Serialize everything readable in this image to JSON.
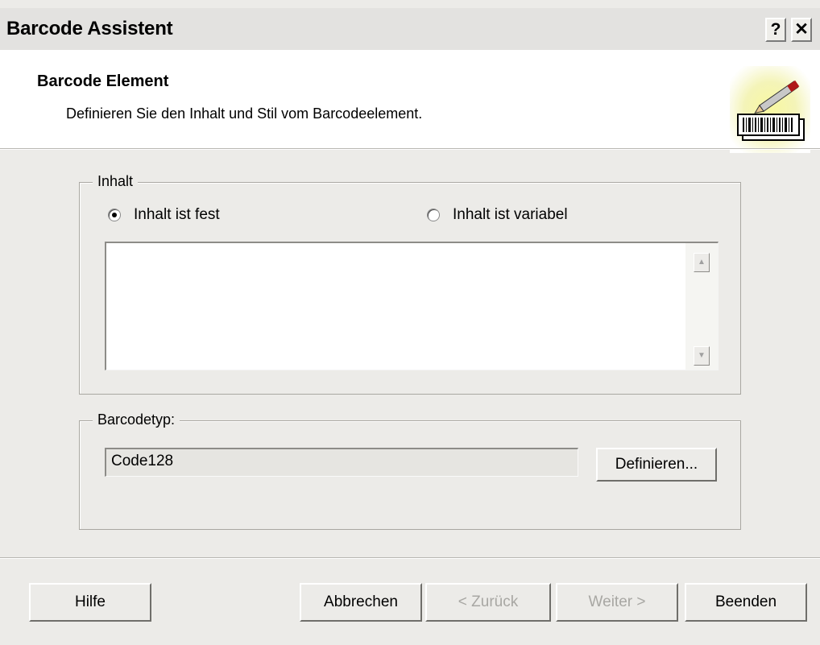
{
  "dialog": {
    "title": "Barcode Assistent",
    "help_button": "?",
    "close_button": "✕"
  },
  "header": {
    "title": "Barcode Element",
    "subtitle": "Definieren Sie den Inhalt und Stil vom Barcodeelement."
  },
  "content_group": {
    "label": "Inhalt",
    "option_fixed": "Inhalt ist fest",
    "option_variable": "Inhalt ist variabel",
    "selected": "Inhalt ist fest",
    "text_value": ""
  },
  "barcode_group": {
    "label": "Barcodetyp:",
    "value": "Code128",
    "define_button": "Definieren..."
  },
  "footer": {
    "help": "Hilfe",
    "cancel": "Abbrechen",
    "back": "< Zurück",
    "next": "Weiter >",
    "finish": "Beenden"
  },
  "icons": {
    "wizard": "barcode-wizard-icon",
    "radio": "radio-icon"
  }
}
